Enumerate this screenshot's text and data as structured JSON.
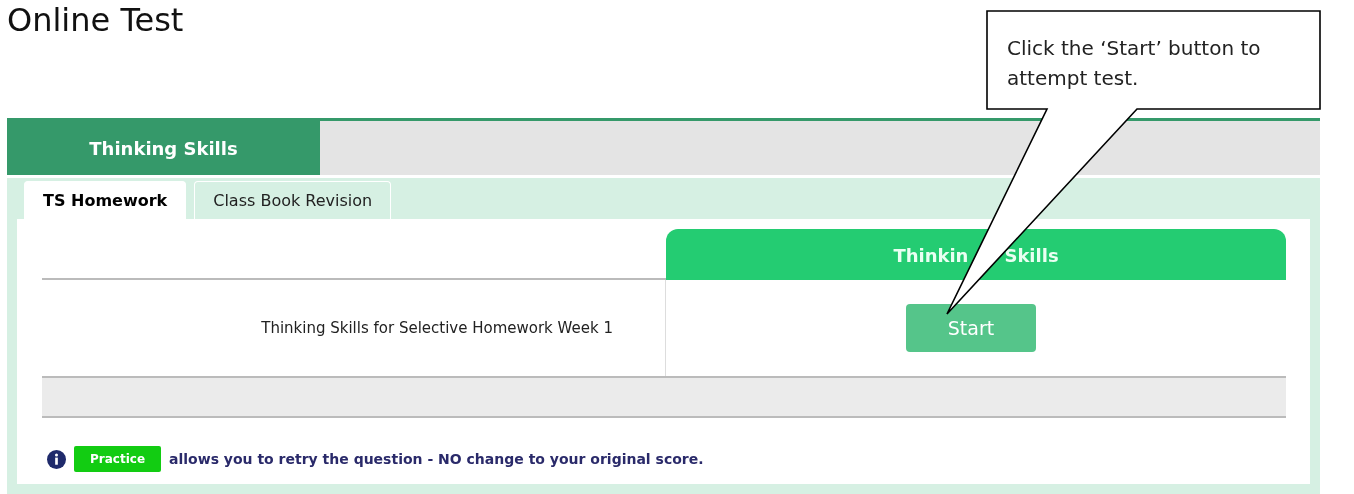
{
  "page_title": "Online Test",
  "subject_tabs": [
    {
      "label": "Thinking Skills",
      "selected": true
    }
  ],
  "sub_tabs": [
    {
      "label": "TS Homework",
      "selected": true
    },
    {
      "label": "Class Book Revision",
      "selected": false
    }
  ],
  "table": {
    "columns": [
      {
        "visible_parts": [
          "Thinkin",
          "Skills"
        ]
      }
    ],
    "rows": [
      {
        "name": "Thinking Skills for Selective Homework Week 1",
        "action": "Start"
      }
    ]
  },
  "note": {
    "badge": "Practice",
    "text": "allows you to retry the question - NO change to your original score."
  },
  "callout": {
    "text": "Click the ‘Start’ button to attempt test."
  }
}
